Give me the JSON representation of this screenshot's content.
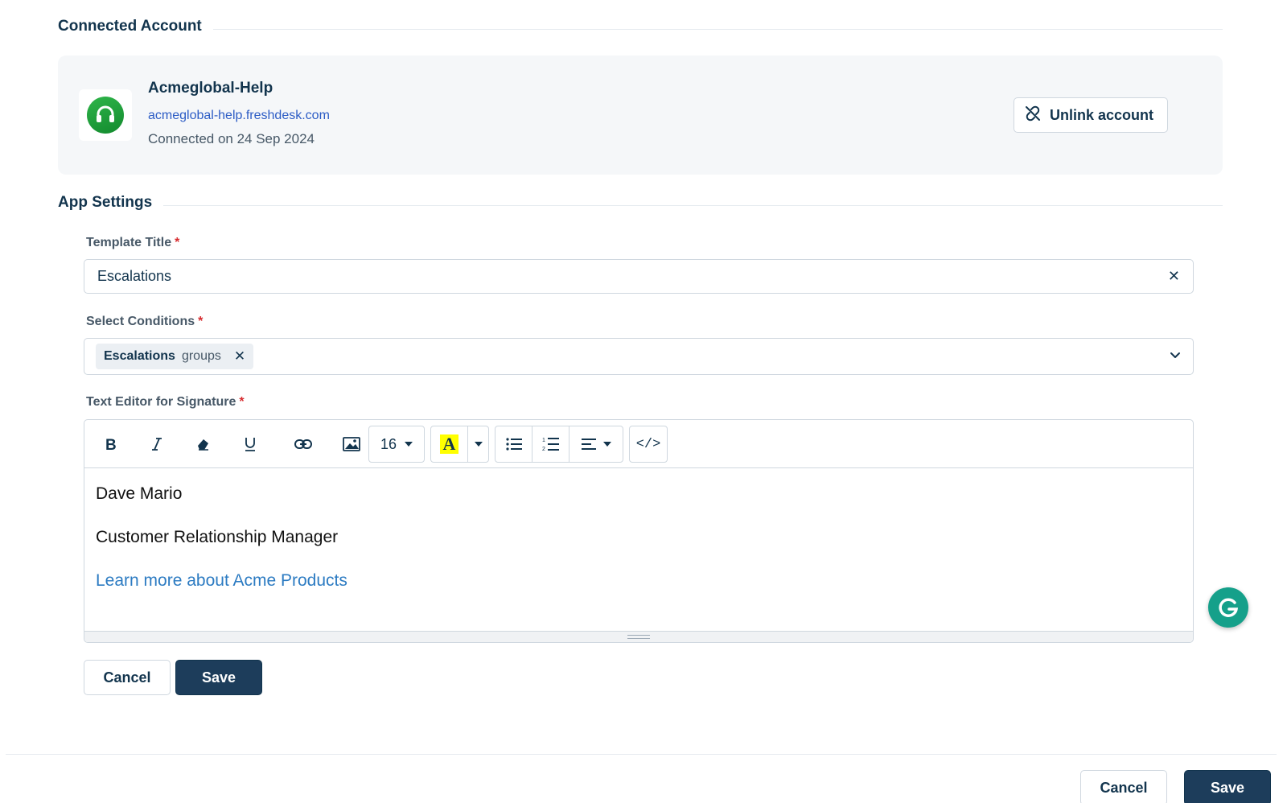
{
  "connected_account": {
    "section_title": "Connected Account",
    "name": "Acmeglobal-Help",
    "url": "acmeglobal-help.freshdesk.com",
    "connected_on": "Connected on 24 Sep 2024",
    "unlink_label": "Unlink account",
    "logo_icon": "headset-icon",
    "logo_color": "#1f9e3c"
  },
  "app_settings": {
    "section_title": "App Settings",
    "template_title": {
      "label": "Template Title",
      "required_mark": "*",
      "value": "Escalations"
    },
    "select_conditions": {
      "label": "Select Conditions",
      "required_mark": "*",
      "chips": [
        {
          "name": "Escalations",
          "type": "groups"
        }
      ]
    },
    "signature_editor": {
      "label": "Text Editor for Signature",
      "required_mark": "*",
      "toolbar": {
        "font_size": "16",
        "highlight_letter": "A",
        "highlight_color": "#ffff00",
        "code_label": "</>"
      },
      "content": {
        "line1": "Dave Mario",
        "line2": "Customer Relationship Manager",
        "link": "Learn more about Acme Products"
      }
    },
    "form_buttons": {
      "cancel": "Cancel",
      "save": "Save"
    }
  },
  "footer_buttons": {
    "cancel": "Cancel",
    "save": "Save"
  },
  "colors": {
    "primary": "#1d3d5b",
    "link": "#2c5cc5",
    "required": "#d72d30",
    "grammarly": "#15a08a"
  }
}
